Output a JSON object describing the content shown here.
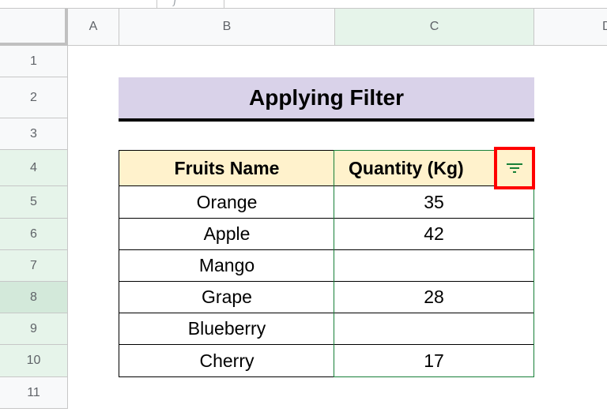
{
  "formula_bar": {
    "icon": "fx-icon"
  },
  "columns": [
    {
      "label": "A",
      "selected": false
    },
    {
      "label": "B",
      "selected": false
    },
    {
      "label": "C",
      "selected": true
    },
    {
      "label": "D",
      "selected": false
    }
  ],
  "rows": [
    {
      "label": "1",
      "state": "none"
    },
    {
      "label": "2",
      "state": "none"
    },
    {
      "label": "3",
      "state": "none"
    },
    {
      "label": "4",
      "state": "selected"
    },
    {
      "label": "5",
      "state": "selected"
    },
    {
      "label": "6",
      "state": "selected"
    },
    {
      "label": "7",
      "state": "selected"
    },
    {
      "label": "8",
      "state": "active"
    },
    {
      "label": "9",
      "state": "selected"
    },
    {
      "label": "10",
      "state": "selected"
    },
    {
      "label": "11",
      "state": "none"
    }
  ],
  "title": "Applying Filter",
  "table": {
    "headers": [
      "Fruits Name",
      "Quantity (Kg)"
    ],
    "rows": [
      [
        "Orange",
        "35"
      ],
      [
        "Apple",
        "42"
      ],
      [
        "Mango",
        ""
      ],
      [
        "Grape",
        "28"
      ],
      [
        "Blueberry",
        ""
      ],
      [
        "Cherry",
        "17"
      ]
    ]
  },
  "filter_button": {
    "icon": "filter-icon",
    "highlight_color": "#ff0000",
    "icon_color": "#188038"
  },
  "colors": {
    "title_bg": "#d9d2e9",
    "header_bg": "#fff2cc",
    "selection": "#188038",
    "selected_header_bg": "#e6f4ea"
  }
}
